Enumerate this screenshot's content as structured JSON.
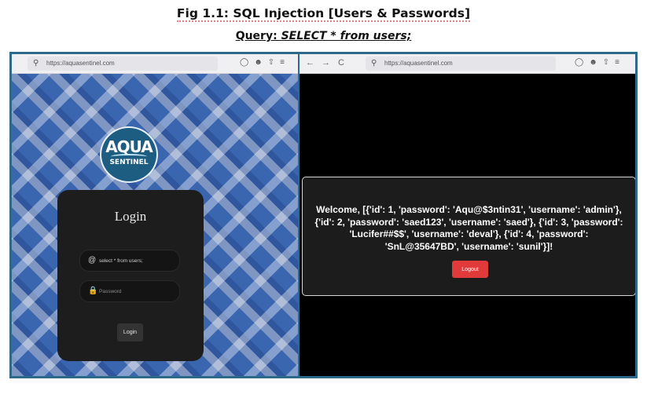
{
  "caption": {
    "figure": "Fig 1.1: SQL Injection [Users & Passwords]",
    "query_label": "Query: ",
    "query_value": "SELECT * from users;"
  },
  "left_browser": {
    "url": "https://aquasentinel.com",
    "search_icon": "search-icon",
    "toolbar_icons": [
      "shield-icon",
      "account-icon",
      "extensions-icon",
      "menu-icon"
    ]
  },
  "right_browser": {
    "nav": {
      "back": "←",
      "forward": "→",
      "reload": "C"
    },
    "url": "https://aquasentinel.com",
    "toolbar_icons": [
      "shield-icon",
      "account-icon",
      "extensions-icon",
      "menu-icon"
    ]
  },
  "logo": {
    "line1": "AQUA",
    "line2": "SENTINEL",
    "color": "#1e5d82"
  },
  "login": {
    "title": "Login",
    "username_value": "select * from users;",
    "password_placeholder": "Password",
    "button_label": "Login"
  },
  "result": {
    "message": "Welcome, [{'id': 1, 'password': 'Aqu@$3ntin31', 'username': 'admin'}, {'id': 2, 'password': 'saed123', 'username': 'saed'}, {'id': 3, 'password': 'Lucifer##$$', 'username': 'deval'}, {'id': 4, 'password': 'SnL@35647BD', 'username': 'sunil'}]!",
    "logout_label": "Logout",
    "logout_color": "#e03a3a"
  },
  "colors": {
    "frame": "#2d6a8a",
    "pattern": "#3a66b0"
  }
}
